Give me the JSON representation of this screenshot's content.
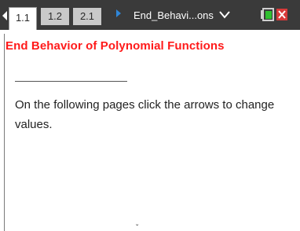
{
  "tabbar": {
    "tabs": [
      {
        "label": "1.1",
        "active": true
      },
      {
        "label": "1.2",
        "active": false
      },
      {
        "label": "2.1",
        "active": false
      }
    ],
    "document_title": "End_Behavi...ons",
    "colors": {
      "bar": "#3a3a3a",
      "next_arrow": "#2f86d8",
      "battery_fill": "#2fbf2f",
      "close": "#d83a3a"
    }
  },
  "page": {
    "title": "End Behavior of Polynomial Functions",
    "title_color": "#ff1a1a",
    "body": "On the following pages click the arrows to change values."
  },
  "icons": {
    "prev": "triangle-left-icon",
    "next": "triangle-right-icon",
    "menu": "chevron-down-icon",
    "battery": "battery-icon"
  }
}
